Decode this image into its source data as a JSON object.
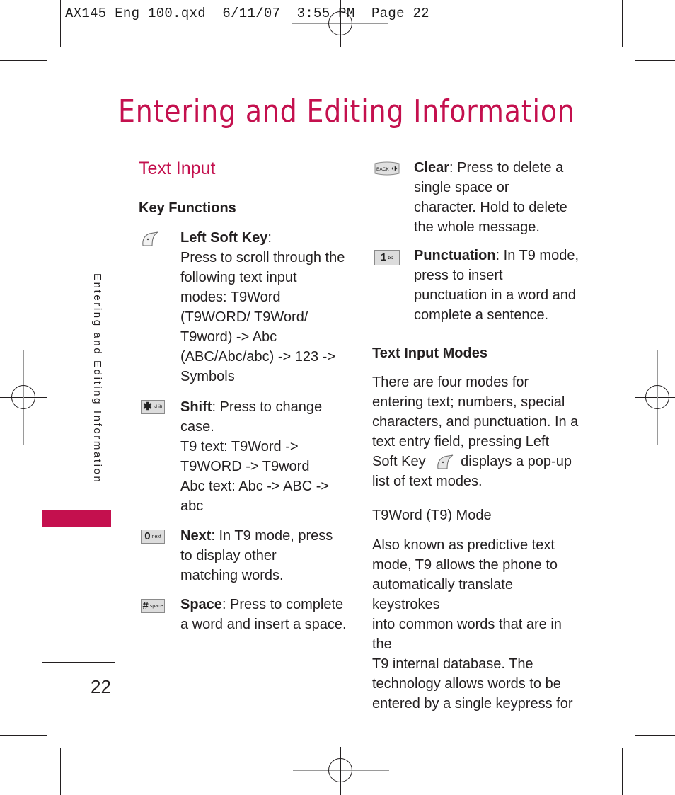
{
  "slug": "AX145_Eng_100.qxd  6/11/07  3:55 PM  Page 22",
  "page_title": "Entering and Editing Information",
  "section_heading": "Text Input",
  "side_tab_label": "Entering and Editing Information",
  "page_number": "22",
  "colors": {
    "accent": "#c4104e",
    "text": "#231f20",
    "key_fill": "#dcdcdc"
  },
  "left_column": {
    "subheading": "Key Functions",
    "items": [
      {
        "icon": "left-soft-key-icon",
        "term": "Left Soft Key",
        "lines": [
          "Press to scroll through the",
          "following text input",
          "modes:  T9Word",
          "(T9WORD/ T9Word/",
          "T9word) -> Abc",
          "(ABC/Abc/abc) -> 123 ->",
          "Symbols"
        ]
      },
      {
        "icon": "star-shift-key-icon",
        "key_big": "✱",
        "key_small": "shift",
        "term": "Shift",
        "first_line_rest": ": Press to change",
        "lines": [
          "case.",
          "T9 text: T9Word ->",
          "T9WORD -> T9word",
          "Abc text: Abc -> ABC ->",
          "abc"
        ]
      },
      {
        "icon": "zero-next-key-icon",
        "key_big": "0",
        "key_small": "next",
        "term": "Next",
        "first_line_rest": ": In T9 mode, press",
        "lines": [
          "to display other",
          "matching words."
        ]
      },
      {
        "icon": "hash-space-key-icon",
        "key_big": "#",
        "key_small": "space",
        "term": "Space",
        "first_line_rest": ": Press to complete",
        "lines": [
          "a word and insert a space."
        ]
      }
    ]
  },
  "right_column": {
    "items": [
      {
        "icon": "back-clear-key-icon",
        "key_label": "BACK",
        "term": "Clear",
        "first_line_rest": ": Press to delete a",
        "lines": [
          "single space or",
          "character. Hold to delete",
          "the whole message."
        ]
      },
      {
        "icon": "one-punctuation-key-icon",
        "key_big": "1",
        "key_small": "✉",
        "term": "Punctuation",
        "first_line_rest": ": In T9 mode,",
        "lines": [
          "press to insert",
          "punctuation in a word and",
          "complete a sentence."
        ]
      }
    ],
    "modes_heading": "Text Input Modes",
    "modes_lines": [
      "There are four modes for",
      "entering text; numbers, special",
      "characters, and punctuation. In a",
      "text entry field, pressing  Left"
    ],
    "modes_softkey_before": "Soft Key",
    "modes_softkey_after": "displays a pop-up",
    "modes_last_line": "list of text modes.",
    "t9_heading": "T9Word (T9) Mode",
    "t9_lines": [
      "Also known as predictive text",
      "mode, T9 allows the phone to",
      "automatically translate keystrokes",
      "into common words that are in the",
      "T9 internal database. The",
      "technology allows words to be",
      "entered by a single keypress for"
    ]
  }
}
